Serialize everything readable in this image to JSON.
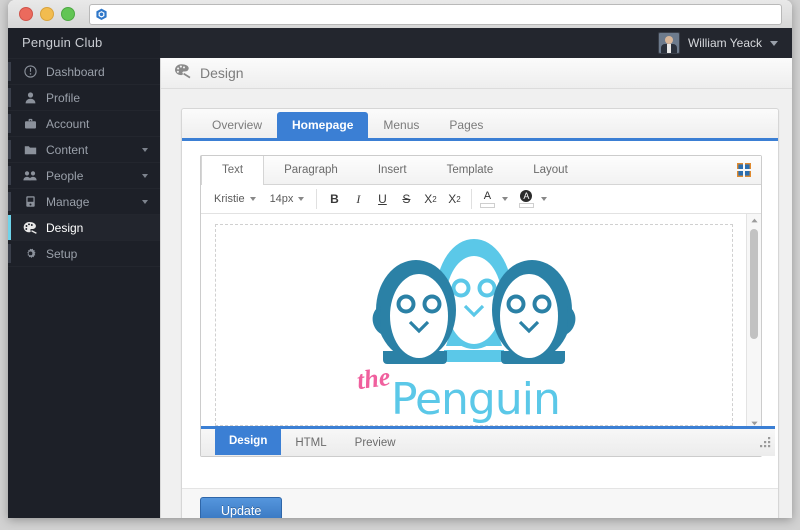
{
  "browser": {
    "address_value": "",
    "address_placeholder": "",
    "favicon": "hexagon-icon"
  },
  "sidebar": {
    "brand": "Penguin Club",
    "items": [
      {
        "label": "Dashboard",
        "icon": "dashboard-icon",
        "caret": false,
        "active": false
      },
      {
        "label": "Profile",
        "icon": "user-icon",
        "caret": false,
        "active": false
      },
      {
        "label": "Account",
        "icon": "briefcase-icon",
        "caret": false,
        "active": false
      },
      {
        "label": "Content",
        "icon": "folder-icon",
        "caret": true,
        "active": false
      },
      {
        "label": "People",
        "icon": "people-icon",
        "caret": true,
        "active": false
      },
      {
        "label": "Manage",
        "icon": "server-icon",
        "caret": true,
        "active": false
      },
      {
        "label": "Design",
        "icon": "palette-icon",
        "caret": false,
        "active": true
      },
      {
        "label": "Setup",
        "icon": "gear-icon",
        "caret": false,
        "active": false
      }
    ]
  },
  "topbar": {
    "user_name": "William Yeack",
    "avatar": "user-avatar-photo",
    "caret": "chevron-down-icon"
  },
  "page": {
    "title": "Design",
    "title_icon": "palette-icon"
  },
  "main_tabs": [
    {
      "label": "Overview",
      "active": false
    },
    {
      "label": "Homepage",
      "active": true
    },
    {
      "label": "Menus",
      "active": false
    },
    {
      "label": "Pages",
      "active": false
    }
  ],
  "editor": {
    "tabs": [
      {
        "label": "Text",
        "active": true
      },
      {
        "label": "Paragraph",
        "active": false
      },
      {
        "label": "Insert",
        "active": false
      },
      {
        "label": "Template",
        "active": false
      },
      {
        "label": "Layout",
        "active": false
      }
    ],
    "expand_icon": "expand-fullscreen-icon",
    "format": {
      "font_family": "Kristie",
      "font_size": "14px",
      "bold": "B",
      "italic": "I",
      "underline": "U",
      "strikethrough": "S",
      "superscript_base": "X",
      "superscript_exp": "2",
      "subscript_base": "X",
      "subscript_exp": "2",
      "text_color_glyph": "A",
      "highlight_glyph": "A"
    },
    "canvas": {
      "logo_the": "the",
      "logo_penguin": "Penguin",
      "penguin_dark_color": "#2b81a6",
      "penguin_light_color": "#5bc8e8",
      "the_color": "#f0609e",
      "penguin_text_color": "#5bc8e8"
    },
    "bottom_tabs": [
      {
        "label": "Design",
        "active": true
      },
      {
        "label": "HTML",
        "active": false
      },
      {
        "label": "Preview",
        "active": false
      }
    ],
    "resize_grip": "resize-grip-icon"
  },
  "footer": {
    "update_label": "Update"
  },
  "colors": {
    "accent": "#3b7fd4",
    "sidebar_bg": "#1d2028",
    "active_indicator": "#6fd3ea"
  }
}
